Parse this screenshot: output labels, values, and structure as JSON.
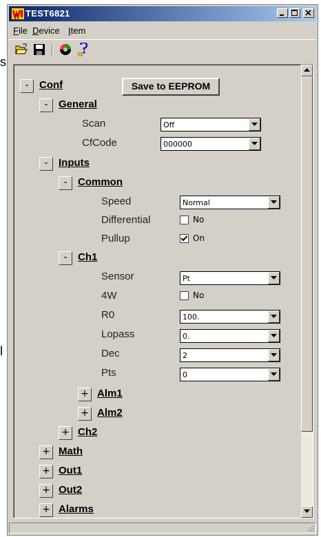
{
  "stray_left": {
    "upper": "s",
    "lower": "l"
  },
  "window": {
    "title": "TEST6821"
  },
  "menubar": {
    "file": {
      "u": "F",
      "rest": "ile"
    },
    "device": {
      "u": "D",
      "rest": "evice"
    },
    "item": {
      "u": "I",
      "rest": "tem"
    }
  },
  "toolbar": {
    "icons": [
      "open-folder-icon",
      "save-disk-icon",
      "device-gauge-icon",
      "help-icon"
    ]
  },
  "tree": {
    "conf": {
      "toggle": "-",
      "label": "Conf",
      "save_button": "Save to EEPROM"
    },
    "general": {
      "toggle": "-",
      "label": "General"
    },
    "scan": {
      "label": "Scan",
      "value": "Off"
    },
    "cfcode": {
      "label": "CfCode",
      "value": "000000"
    },
    "inputs": {
      "toggle": "-",
      "label": "Inputs"
    },
    "common": {
      "toggle": "-",
      "label": "Common"
    },
    "speed": {
      "label": "Speed",
      "value": "Normal"
    },
    "differential": {
      "label": "Differential",
      "checked": false,
      "text": "No"
    },
    "pullup": {
      "label": "Pullup",
      "checked": true,
      "text": "On"
    },
    "ch1": {
      "toggle": "-",
      "label": "Ch1"
    },
    "sensor": {
      "label": "Sensor",
      "value": "Pt"
    },
    "fourw": {
      "label": "4W",
      "checked": false,
      "text": "No"
    },
    "r0": {
      "label": "R0",
      "value": "100."
    },
    "lopass": {
      "label": "Lopass",
      "value": "0."
    },
    "dec": {
      "label": "Dec",
      "value": "2"
    },
    "pts": {
      "label": "Pts",
      "value": "0"
    },
    "alm1": {
      "toggle": "+",
      "label": "Alm1"
    },
    "alm2": {
      "toggle": "+",
      "label": "Alm2"
    },
    "ch2": {
      "toggle": "+",
      "label": "Ch2"
    },
    "math": {
      "toggle": "+",
      "label": "Math"
    },
    "out1": {
      "toggle": "+",
      "label": "Out1"
    },
    "out2": {
      "toggle": "+",
      "label": "Out2"
    },
    "alarms": {
      "toggle": "+",
      "label": "Alarms"
    }
  },
  "colors": {
    "title_start": "#0a246a",
    "title_end": "#a6caf0",
    "face": "#d4d0c8"
  }
}
